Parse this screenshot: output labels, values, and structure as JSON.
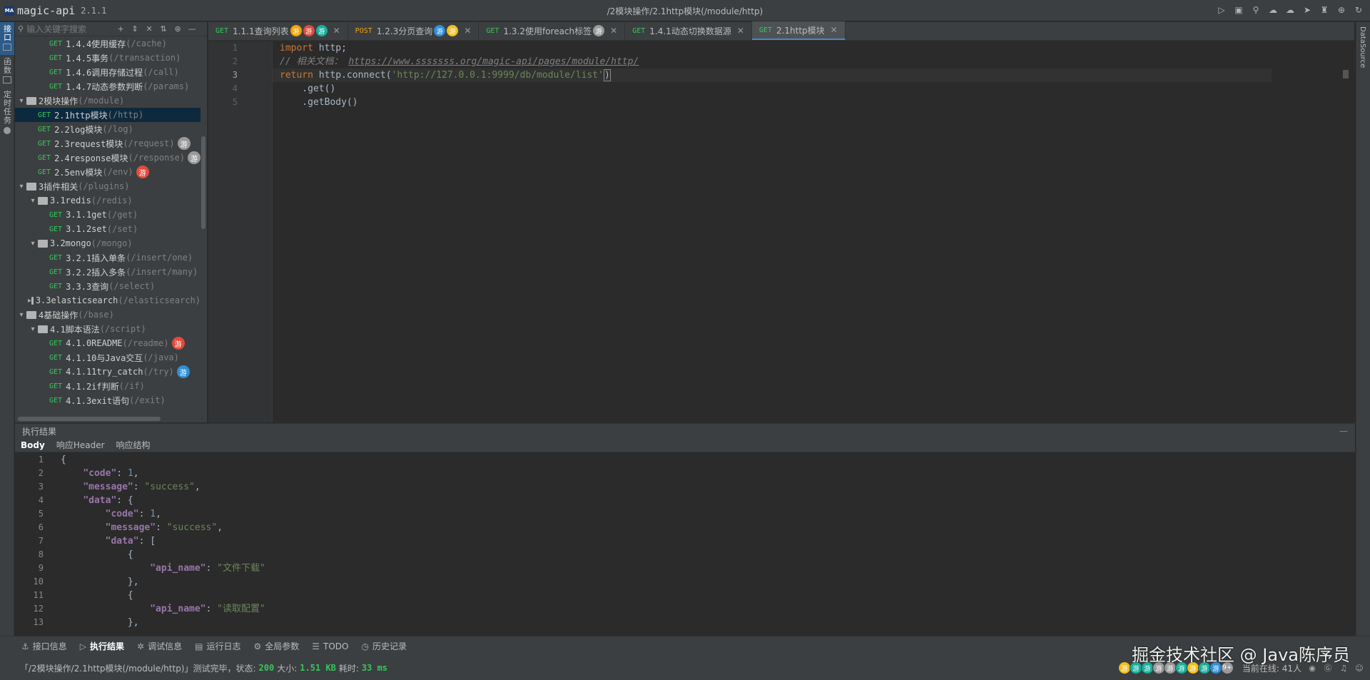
{
  "app": {
    "name": "magic-api",
    "version": "2.1.1",
    "title_path": "/2模块操作/2.1http模块(/module/http)"
  },
  "left_strip": [
    {
      "label": "接口",
      "active": true
    },
    {
      "label": "函数",
      "active": false
    },
    {
      "label": "定时任务",
      "active": false
    }
  ],
  "search": {
    "placeholder": "输入关键字搜索"
  },
  "tree": [
    {
      "indent": 2,
      "type": "api",
      "method": "GET",
      "name": "1.4.4使用缓存",
      "path": "(/cache)"
    },
    {
      "indent": 2,
      "type": "api",
      "method": "GET",
      "name": "1.4.5事务",
      "path": "(/transaction)"
    },
    {
      "indent": 2,
      "type": "api",
      "method": "GET",
      "name": "1.4.6调用存储过程",
      "path": "(/call)"
    },
    {
      "indent": 2,
      "type": "api",
      "method": "GET",
      "name": "1.4.7动态参数判断",
      "path": "(/params)"
    },
    {
      "indent": 0,
      "type": "folder",
      "name": "2模块操作",
      "path": "(/module)",
      "open": true
    },
    {
      "indent": 1,
      "type": "api",
      "method": "GET",
      "name": "2.1http模块",
      "path": "(/http)",
      "selected": true
    },
    {
      "indent": 1,
      "type": "api",
      "method": "GET",
      "name": "2.2log模块",
      "path": "(/log)"
    },
    {
      "indent": 1,
      "type": "api",
      "method": "GET",
      "name": "2.3request模块",
      "path": "(/request)",
      "badge": "游",
      "badge_color": "#9a9a9a"
    },
    {
      "indent": 1,
      "type": "api",
      "method": "GET",
      "name": "2.4response模块",
      "path": "(/response)",
      "badge": "游",
      "badge_color": "#9a9a9a"
    },
    {
      "indent": 1,
      "type": "api",
      "method": "GET",
      "name": "2.5env模块",
      "path": "(/env)",
      "badge": "游",
      "badge_color": "#e04b3c"
    },
    {
      "indent": 0,
      "type": "folder",
      "name": "3插件相关",
      "path": "(/plugins)",
      "open": true
    },
    {
      "indent": 1,
      "type": "folder",
      "name": "3.1redis",
      "path": "(/redis)",
      "open": true
    },
    {
      "indent": 2,
      "type": "api",
      "method": "GET",
      "name": "3.1.1get",
      "path": "(/get)"
    },
    {
      "indent": 2,
      "type": "api",
      "method": "GET",
      "name": "3.1.2set",
      "path": "(/set)"
    },
    {
      "indent": 1,
      "type": "folder",
      "name": "3.2mongo",
      "path": "(/mongo)",
      "open": true
    },
    {
      "indent": 2,
      "type": "api",
      "method": "GET",
      "name": "3.2.1插入单条",
      "path": "(/insert/one)"
    },
    {
      "indent": 2,
      "type": "api",
      "method": "GET",
      "name": "3.2.2插入多条",
      "path": "(/insert/many)"
    },
    {
      "indent": 2,
      "type": "api",
      "method": "GET",
      "name": "3.3.3查询",
      "path": "(/select)"
    },
    {
      "indent": 1,
      "type": "folder",
      "name": "3.3elasticsearch",
      "path": "(/elasticsearch)",
      "open": false
    },
    {
      "indent": 0,
      "type": "folder",
      "name": "4基础操作",
      "path": "(/base)",
      "open": true
    },
    {
      "indent": 1,
      "type": "folder",
      "name": "4.1脚本语法",
      "path": "(/script)",
      "open": true
    },
    {
      "indent": 2,
      "type": "api",
      "method": "GET",
      "name": "4.1.0README",
      "path": "(/readme)",
      "badge": "游",
      "badge_color": "#e04b3c"
    },
    {
      "indent": 2,
      "type": "api",
      "method": "GET",
      "name": "4.1.10与Java交互",
      "path": "(/java)"
    },
    {
      "indent": 2,
      "type": "api",
      "method": "GET",
      "name": "4.1.11try_catch",
      "path": "(/try)",
      "badge": "游",
      "badge_color": "#2f8fd8"
    },
    {
      "indent": 2,
      "type": "api",
      "method": "GET",
      "name": "4.1.2if判断",
      "path": "(/if)"
    },
    {
      "indent": 2,
      "type": "api",
      "method": "GET",
      "name": "4.1.3exit语句",
      "path": "(/exit)"
    }
  ],
  "tabs": [
    {
      "method": "GET",
      "label": "1.1.1查询列表",
      "badges": [
        {
          "t": "游",
          "c": "#f0a30a"
        },
        {
          "t": "游",
          "c": "#e04b3c"
        },
        {
          "t": "游",
          "c": "#1aaf9b"
        }
      ]
    },
    {
      "method": "POST",
      "label": "1.2.3分页查询",
      "badges": [
        {
          "t": "游",
          "c": "#2f8fd8"
        },
        {
          "t": "游",
          "c": "#f0c020"
        }
      ]
    },
    {
      "method": "GET",
      "label": "1.3.2使用foreach标签",
      "badges": [
        {
          "t": "游",
          "c": "#9a9a9a"
        }
      ]
    },
    {
      "method": "GET",
      "label": "1.4.1动态切换数据源",
      "badges": []
    },
    {
      "method": "GET",
      "label": "2.1http模块",
      "badges": [],
      "active": true
    }
  ],
  "code": {
    "line_numbers": [
      "1",
      "2",
      "3",
      "4",
      "5"
    ],
    "l1_kw": "import",
    "l1_rest": " http;",
    "l2_comment": "// 相关文档： ",
    "l2_url": "https://www.sssssss.org/magic-api/pages/module/http/",
    "l3_kw": "return",
    "l3_a": " http.connect(",
    "l3_str": "'http://127.0.0.1:9999/db/module/list'",
    "l3_b": ")",
    "l4": "    .get()",
    "l5": "    .getBody()"
  },
  "result": {
    "title": "执行结果",
    "tabs": [
      "Body",
      "响应Header",
      "响应结构"
    ],
    "line_numbers": [
      "1",
      "2",
      "3",
      "4",
      "5",
      "6",
      "7",
      "8",
      "9",
      "10",
      "11",
      "12",
      "13"
    ],
    "code_key": "\"code\"",
    "code_val": "1",
    "message_key": "\"message\"",
    "message_val": "\"success\"",
    "data_key": "\"data\"",
    "api_name_key": "\"api_name\"",
    "api_name_1": "\"文件下载\"",
    "api_name_2": "\"读取配置\""
  },
  "tool_tabs": [
    {
      "icon": "interface-icon",
      "glyph": "⚓",
      "label": "接口信息"
    },
    {
      "icon": "play-icon",
      "glyph": "▷",
      "label": "执行结果",
      "active": true
    },
    {
      "icon": "debug-icon",
      "glyph": "✲",
      "label": "调试信息"
    },
    {
      "icon": "log-icon",
      "glyph": "▤",
      "label": "运行日志"
    },
    {
      "icon": "settings-icon",
      "glyph": "⚙",
      "label": "全局参数"
    },
    {
      "icon": "list-icon",
      "glyph": "☰",
      "label": "TODO"
    },
    {
      "icon": "history-icon",
      "glyph": "◷",
      "label": "历史记录"
    }
  ],
  "status": {
    "prefix": "「/2模块操作/2.1http模块(/module/http)」测试完毕，状态:",
    "status_code": "200",
    "size_label": "大小:",
    "size": "1.51 KB",
    "time_label": "耗时:",
    "time": "33 ms",
    "online_label": "当前在线: 41人",
    "overflow_badge": "9+"
  },
  "watermark": "掘金技术社区 @ Java陈序员",
  "right_strip_label": "DataSource",
  "colors": {
    "accent": "#4a88c7",
    "get": "#34c759",
    "post": "#f0a30a",
    "selected_row": "#0d293e"
  }
}
